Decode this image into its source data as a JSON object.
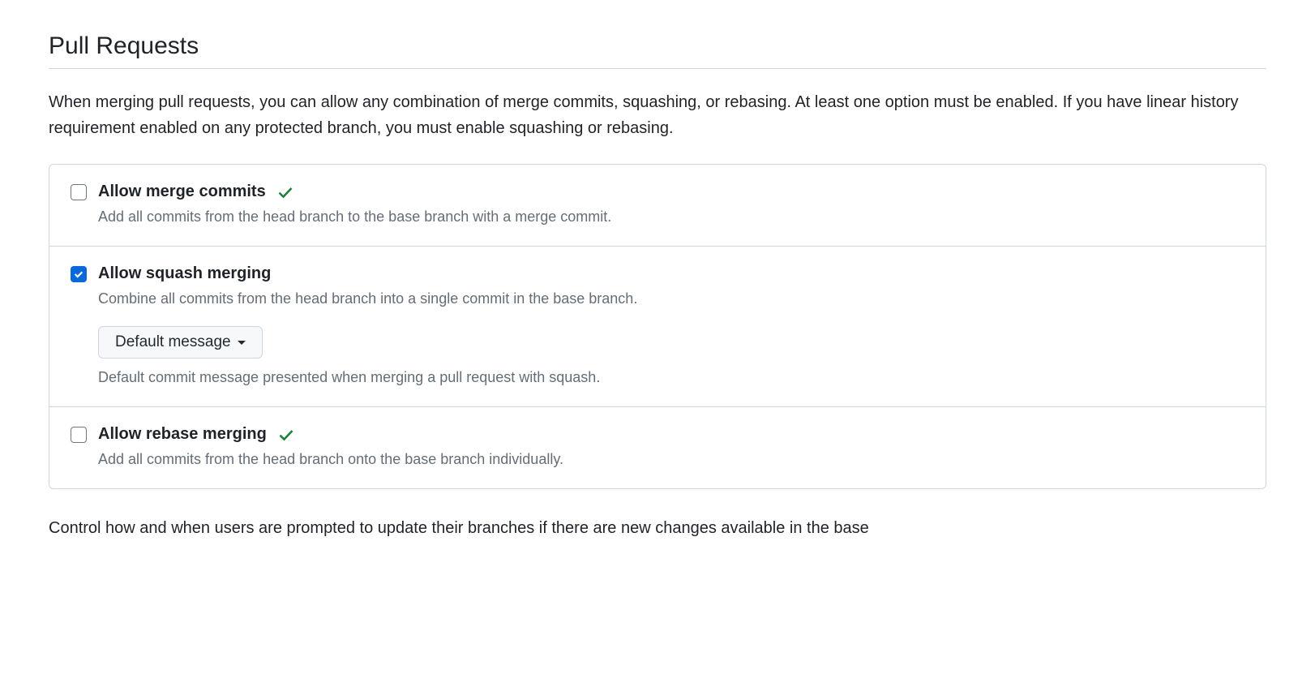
{
  "section": {
    "title": "Pull Requests",
    "intro": "When merging pull requests, you can allow any combination of merge commits, squashing, or rebasing. At least one option must be enabled. If you have linear history requirement enabled on any protected branch, you must enable squashing or rebasing."
  },
  "options": {
    "merge_commits": {
      "label": "Allow merge commits",
      "description": "Add all commits from the head branch to the base branch with a merge commit.",
      "checked": false,
      "show_success": true
    },
    "squash": {
      "label": "Allow squash merging",
      "description": "Combine all commits from the head branch into a single commit in the base branch.",
      "checked": true,
      "show_success": false,
      "dropdown_label": "Default message",
      "dropdown_description": "Default commit message presented when merging a pull request with squash."
    },
    "rebase": {
      "label": "Allow rebase merging",
      "description": "Add all commits from the head branch onto the base branch individually.",
      "checked": false,
      "show_success": true
    }
  },
  "footer": "Control how and when users are prompted to update their branches if there are new changes available in the base"
}
